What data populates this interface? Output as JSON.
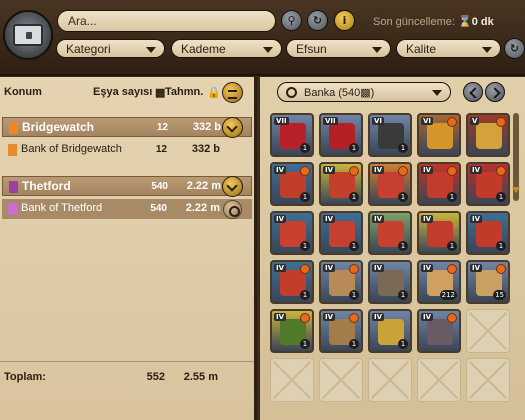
{
  "header": {
    "search_placeholder": "Ara...",
    "last_update_label": "Son güncelleme:",
    "last_update_value": "0 dk",
    "filters": [
      {
        "label": "Kategori"
      },
      {
        "label": "Kademe"
      },
      {
        "label": "Efsun"
      },
      {
        "label": "Kalite"
      }
    ]
  },
  "left": {
    "col_location": "Konum",
    "col_count": "Eşya sayısı",
    "col_estimate": "Tahmn.",
    "locations": [
      {
        "name": "Bridgewatch",
        "count": "12",
        "value": "332 b",
        "flag_color": "#e88a2a"
      },
      {
        "name": "Bank of Bridgewatch",
        "count": "12",
        "value": "332 b",
        "flag_color": "#e88a2a"
      },
      {
        "name": "Thetford",
        "count": "540",
        "value": "2.22 m",
        "flag_color": "#9b3fa3"
      },
      {
        "name": "Bank of Thetford",
        "count": "540",
        "value": "2.22 m",
        "flag_color": "#9b3fa3"
      }
    ],
    "total_label": "Toplam:",
    "total_count": "552",
    "total_value": "2.55 m"
  },
  "right": {
    "bank_select": "Banka (540",
    "slots": [
      {
        "item": "red-cape-icon",
        "color": "#b8212a",
        "bg": "#6f85a6",
        "tier": "VII",
        "enchant": false,
        "qty": "1"
      },
      {
        "item": "red-cape-icon",
        "color": "#b52024",
        "bg": "#6f85a6",
        "tier": "VII",
        "enchant": false,
        "qty": "1"
      },
      {
        "item": "crossbow-icon",
        "color": "#3a3a3a",
        "bg": "#6f85a6",
        "tier": "VI",
        "enchant": false,
        "qty": "1"
      },
      {
        "item": "potion-icon",
        "color": "#d6952a",
        "bg": "#a5673a",
        "tier": "VI",
        "enchant": true,
        "qty": ""
      },
      {
        "item": "potion-icon",
        "color": "#d4a23a",
        "bg": "#9b3b2a",
        "tier": "V",
        "enchant": true,
        "qty": ""
      },
      {
        "item": "tome-icon",
        "color": "#c23e2c",
        "bg": "#3f6f95",
        "tier": "IV",
        "enchant": true,
        "qty": "1"
      },
      {
        "item": "tome-icon",
        "color": "#c43f2c",
        "bg": "#c9b33d",
        "tier": "IV",
        "enchant": true,
        "qty": "1"
      },
      {
        "item": "tome-icon",
        "color": "#c54030",
        "bg": "#d07c35",
        "tier": "IV",
        "enchant": true,
        "qty": "1"
      },
      {
        "item": "tome-icon",
        "color": "#c33b2c",
        "bg": "#c03528",
        "tier": "IV",
        "enchant": true,
        "qty": "1"
      },
      {
        "item": "tome-icon",
        "color": "#c13a2a",
        "bg": "#b8312a",
        "tier": "IV",
        "enchant": true,
        "qty": "1"
      },
      {
        "item": "tome-icon",
        "color": "#c74030",
        "bg": "#3f6f95",
        "tier": "IV",
        "enchant": false,
        "qty": "1"
      },
      {
        "item": "tome-icon",
        "color": "#c54030",
        "bg": "#3d6f95",
        "tier": "IV",
        "enchant": false,
        "qty": "1"
      },
      {
        "item": "tome-icon",
        "color": "#c74030",
        "bg": "#7aa06a",
        "tier": "IV",
        "enchant": false,
        "qty": "1"
      },
      {
        "item": "tome-icon",
        "color": "#c33b2c",
        "bg": "#c9b33d",
        "tier": "IV",
        "enchant": false,
        "qty": "1"
      },
      {
        "item": "tome-icon",
        "color": "#c13a2a",
        "bg": "#3f6f95",
        "tier": "IV",
        "enchant": false,
        "qty": "1"
      },
      {
        "item": "tome-icon",
        "color": "#c23e2c",
        "bg": "#3f6f95",
        "tier": "IV",
        "enchant": true,
        "qty": "1"
      },
      {
        "item": "armor-icon",
        "color": "#b88a5a",
        "bg": "#6f85a6",
        "tier": "IV",
        "enchant": true,
        "qty": "1"
      },
      {
        "item": "pickaxe-icon",
        "color": "#7a6a55",
        "bg": "#6f85a6",
        "tier": "IV",
        "enchant": false,
        "qty": "1"
      },
      {
        "item": "bag-icon",
        "color": "#d0a060",
        "bg": "#6f85a6",
        "tier": "IV",
        "enchant": true,
        "qty": "212"
      },
      {
        "item": "shield-icon",
        "color": "#c8a060",
        "bg": "#6f85a6",
        "tier": "IV",
        "enchant": true,
        "qty": "15"
      },
      {
        "item": "boots-icon",
        "color": "#4e7a2a",
        "bg": "#c9b33d",
        "tier": "IV",
        "enchant": true,
        "qty": "1"
      },
      {
        "item": "hammer-icon",
        "color": "#a47c4a",
        "bg": "#6f85a6",
        "tier": "IV",
        "enchant": true,
        "qty": "1"
      },
      {
        "item": "staff-icon",
        "color": "#c9a23a",
        "bg": "#6f85a6",
        "tier": "IV",
        "enchant": false,
        "qty": "1"
      },
      {
        "item": "hood-icon",
        "color": "#6a5a66",
        "bg": "#6f85a6",
        "tier": "IV",
        "enchant": true,
        "qty": ""
      }
    ]
  }
}
